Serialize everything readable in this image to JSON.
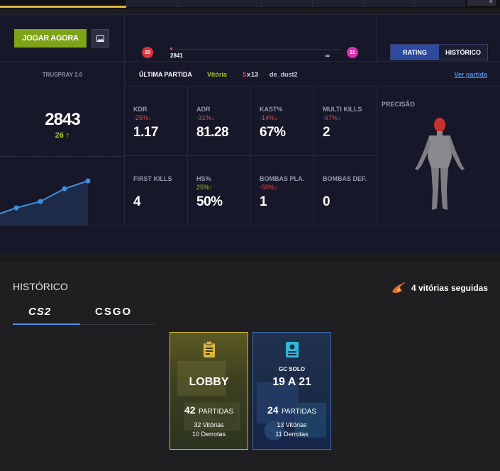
{
  "top": {
    "corner_label": "#"
  },
  "header": {
    "play_label": "JOGAR AGORA",
    "team_a_score": "20",
    "team_b_score": "21",
    "elo_left": "2841",
    "elo_right": "∞",
    "toggle": {
      "rating_label": "RATING",
      "history_label": "HISTÓRICO"
    }
  },
  "side": {
    "title": "TRUSPRAY 2.0",
    "rating": "2843",
    "delta": "26",
    "delta_arrow": "↑"
  },
  "last_match": {
    "label": "ÚLTIMA PARTIDA",
    "result": "Vitória",
    "score_left": "5",
    "score_sep": "x",
    "score_right": "13",
    "map": "de_dust2",
    "link": "Ver partida"
  },
  "stats": [
    {
      "name": "KDR",
      "delta": "-25%↓",
      "delta_type": "neg",
      "value": "1.17"
    },
    {
      "name": "ADR",
      "delta": "-31%↓",
      "delta_type": "neg",
      "value": "81.28"
    },
    {
      "name": "KAST%",
      "delta": "-14%↓",
      "delta_type": "neg",
      "value": "67%"
    },
    {
      "name": "MULTI KILLS",
      "delta": "-67%↓",
      "delta_type": "neg",
      "value": "2"
    },
    {
      "name": "FIRST KILLS",
      "delta": "",
      "delta_type": "",
      "value": "4"
    },
    {
      "name": "HS%",
      "delta": "25%↑",
      "delta_type": "pos",
      "value": "50%"
    },
    {
      "name": "BOMBAS PLA.",
      "delta": "-50%↓",
      "delta_type": "neg",
      "value": "1"
    },
    {
      "name": "BOMBAS DEF.",
      "delta": "",
      "delta_type": "",
      "value": "0"
    }
  ],
  "precision": {
    "title": "PRECISÃO"
  },
  "history": {
    "title": "HISTÓRICO",
    "streak": "4 vitórias seguidas",
    "tabs": [
      "CS2",
      "CSGO"
    ],
    "cards": [
      {
        "subtitle": "",
        "title": "LOBBY",
        "matches": "42",
        "matches_label": "PARTIDAS",
        "wins": "32 Vitórias",
        "losses": "10 Derrotas"
      },
      {
        "subtitle": "GC SOLO",
        "title": "19 A 21",
        "matches": "24",
        "matches_label": "PARTIDAS",
        "wins": "13 Vitórias",
        "losses": "11 Derrotas"
      }
    ]
  },
  "colors": {
    "accent_green": "#7fa316",
    "accent_blue": "#2e4a9e",
    "negative": "#e64848",
    "positive": "#a3c62a",
    "link": "#4b8fe6"
  }
}
